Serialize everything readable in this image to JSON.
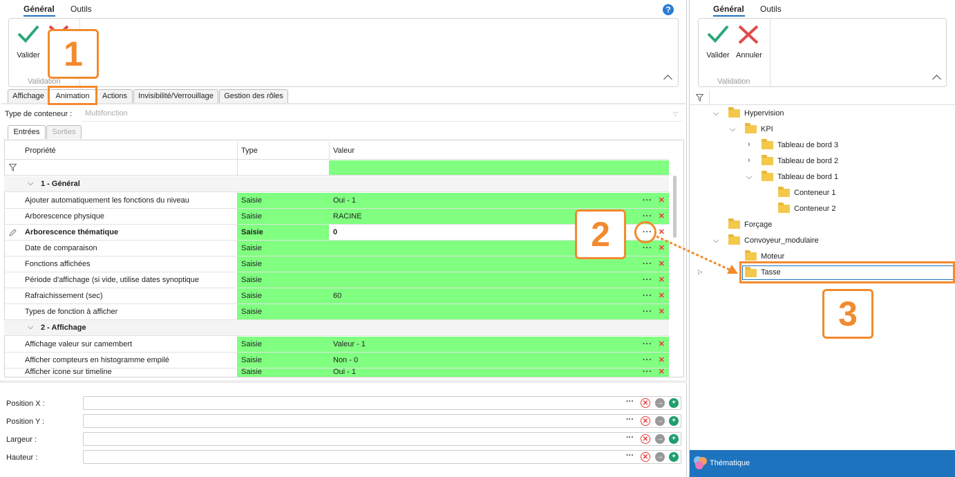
{
  "left_ribbon": {
    "tabs": [
      "Général",
      "Outils"
    ],
    "validate": "Valider",
    "group": "Validation"
  },
  "right_ribbon": {
    "tabs": [
      "Général",
      "Outils"
    ],
    "validate": "Valider",
    "cancel": "Annuler",
    "group": "Validation"
  },
  "main_tabs": [
    "Affichage",
    "Animation",
    "Actions",
    "Invisibilité/Verrouillage",
    "Gestion des rôles"
  ],
  "container": {
    "label": "Type de conteneur :",
    "value": "Multifonction"
  },
  "sub_tabs": [
    "Entrées",
    "Sorties"
  ],
  "grid": {
    "headers": [
      "Propriété",
      "Type",
      "Valeur"
    ],
    "group1": "1 - Général",
    "rows1": [
      {
        "prop": "Ajouter automatiquement les fonctions du niveau",
        "type": "Saisie",
        "value": "Oui - 1"
      },
      {
        "prop": "Arborescence physique",
        "type": "Saisie",
        "value": "RACINE"
      },
      {
        "prop": "Arborescence thématique",
        "type": "Saisie",
        "value": "0"
      },
      {
        "prop": "Date de comparaison",
        "type": "Saisie",
        "value": ""
      },
      {
        "prop": "Fonctions affichées",
        "type": "Saisie",
        "value": ""
      },
      {
        "prop": "Période d'affichage (si vide, utilise dates synoptique",
        "type": "Saisie",
        "value": ""
      },
      {
        "prop": "Rafraichissement (sec)",
        "type": "Saisie",
        "value": "60"
      },
      {
        "prop": "Types de fonction à afficher",
        "type": "Saisie",
        "value": ""
      }
    ],
    "group2": "2 - Affichage",
    "rows2": [
      {
        "prop": "Affichage valeur sur camembert",
        "type": "Saisie",
        "value": "Valeur - 1"
      },
      {
        "prop": "Afficher compteurs en histogramme empilé",
        "type": "Saisie",
        "value": "Non - 0"
      },
      {
        "prop": "Afficher icone sur timeline",
        "type": "Saisie",
        "value": "Oui - 1"
      }
    ]
  },
  "position_fields": [
    "Position X :",
    "Position Y :",
    "Largeur :",
    "Hauteur :"
  ],
  "tree": [
    "Hypervision",
    "KPI",
    "Tableau de bord 3",
    "Tableau de bord 2",
    "Tableau de bord 1",
    "Conteneur 1",
    "Conteneur 2",
    "Forçage",
    "Convoyeur_modulaire",
    "Moteur",
    "Tasse"
  ],
  "footer": "Thématique",
  "annotations": [
    "1",
    "2",
    "3"
  ],
  "colors": {
    "green": "#80ff80",
    "orange": "#f28a2e",
    "footer": "#1e73be"
  }
}
